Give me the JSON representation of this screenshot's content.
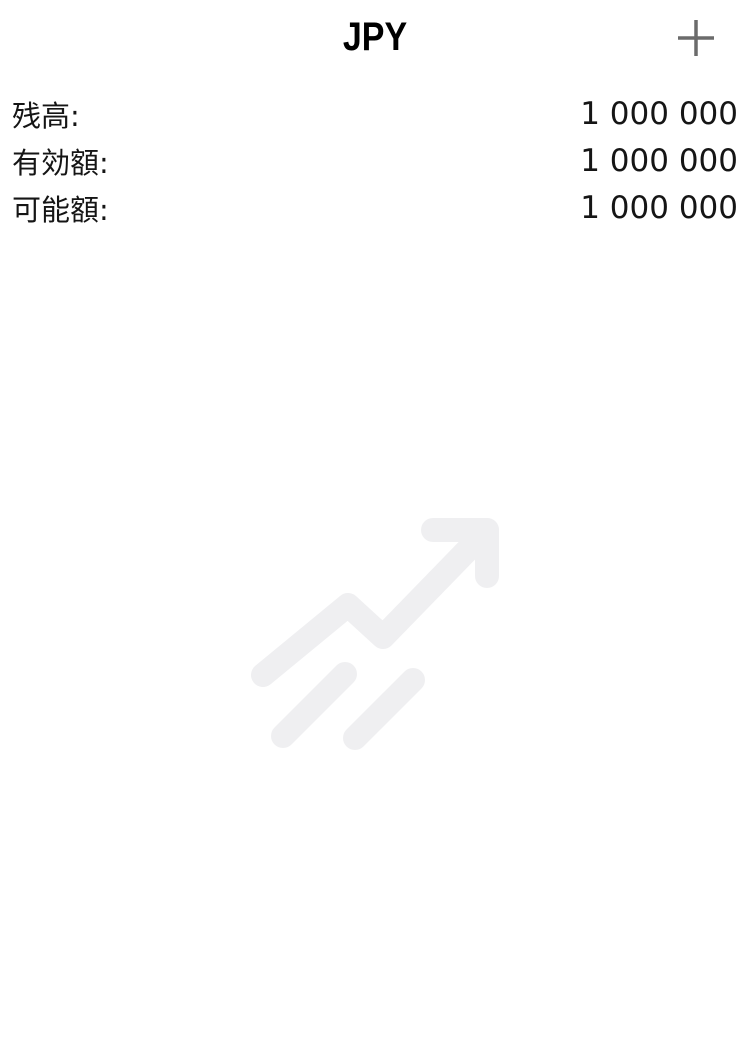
{
  "header": {
    "title": "JPY",
    "add_icon": "plus-icon"
  },
  "balances": [
    {
      "label": "残高:",
      "value": "1 000 000"
    },
    {
      "label": "有効額:",
      "value": "1 000 000"
    },
    {
      "label": "可能額:",
      "value": "1 000 000"
    }
  ],
  "empty_state": {
    "icon": "trend-up-icon",
    "icon_color": "#efeff1"
  },
  "colors": {
    "text": "#151515",
    "add_icon": "#6b6b6b"
  }
}
